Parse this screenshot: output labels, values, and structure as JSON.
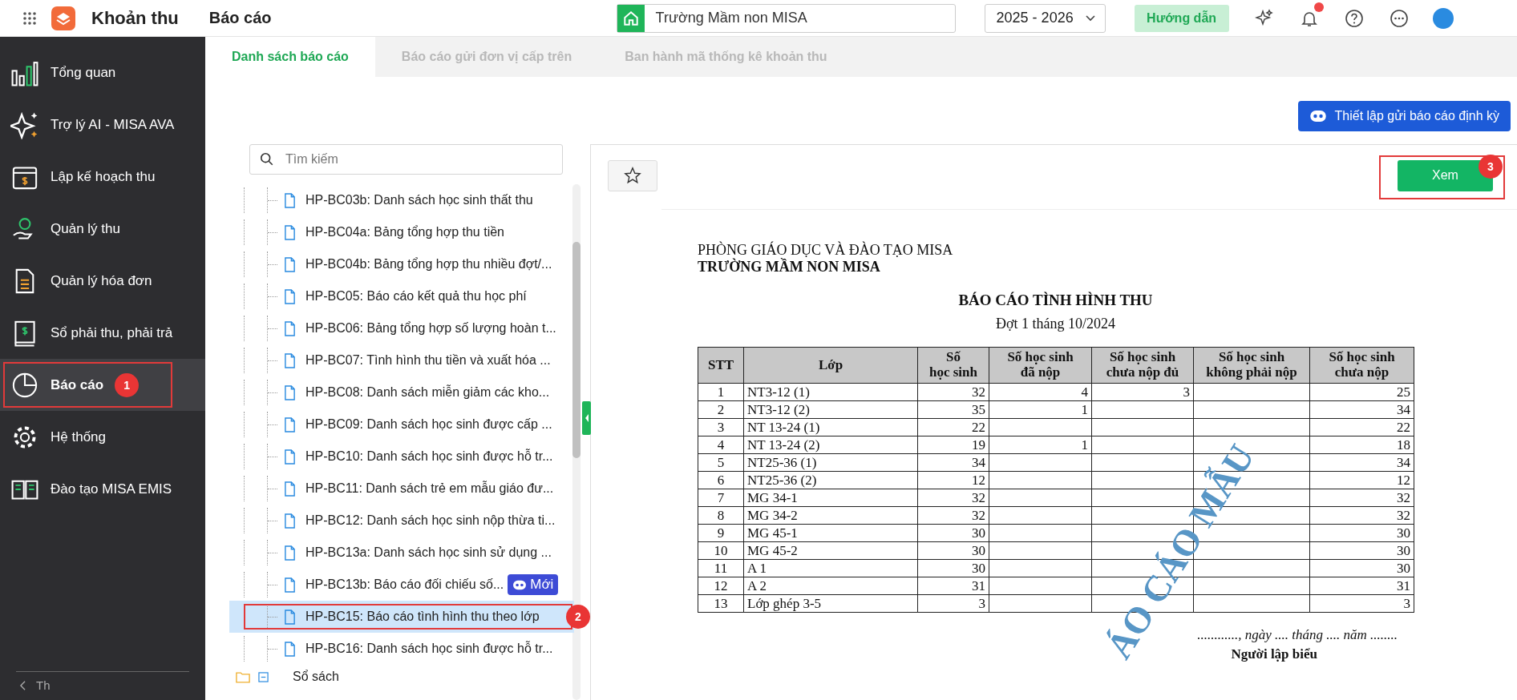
{
  "topbar": {
    "app_name": "Khoản thu",
    "page_title": "Báo cáo",
    "school": "Trường Mầm non MISA",
    "year": "2025 - 2026",
    "help_button": "Hướng dẫn"
  },
  "tabs": [
    {
      "label": "Danh sách báo cáo",
      "selected": true
    },
    {
      "label": "Báo cáo gửi đơn vị cấp trên",
      "selected": false
    },
    {
      "label": "Ban hành mã thống kê khoản thu",
      "selected": false
    }
  ],
  "sidebar": {
    "items": [
      {
        "label": "Tổng quan",
        "selected": false
      },
      {
        "label": "Trợ lý AI - MISA AVA",
        "selected": false
      },
      {
        "label": "Lập kế hoạch thu",
        "selected": false
      },
      {
        "label": "Quản lý thu",
        "selected": false
      },
      {
        "label": "Quản lý hóa đơn",
        "selected": false
      },
      {
        "label": "Sổ phải thu, phải trả",
        "selected": false
      },
      {
        "label": "Báo cáo",
        "selected": true,
        "callout": "1"
      },
      {
        "label": "Hệ thống",
        "selected": false
      },
      {
        "label": "Đào tạo MISA EMIS",
        "selected": false
      }
    ],
    "collapse_label": "Th"
  },
  "schedule_button": "Thiết lập gửi báo cáo định kỳ",
  "report_list": {
    "search_placeholder": "Tìm kiếm",
    "items": [
      {
        "label": "HP-BC03b: Danh sách học sinh thất thu",
        "selected": false
      },
      {
        "label": "HP-BC04a: Bảng tổng hợp thu tiền",
        "selected": false
      },
      {
        "label": "HP-BC04b: Bảng tổng hợp thu nhiều đợt/...",
        "selected": false
      },
      {
        "label": "HP-BC05: Báo cáo kết quả thu học phí",
        "selected": false
      },
      {
        "label": "HP-BC06: Bảng tổng hợp số lượng hoàn t...",
        "selected": false
      },
      {
        "label": "HP-BC07: Tình hình thu tiền và xuất hóa ...",
        "selected": false
      },
      {
        "label": "HP-BC08: Danh sách miễn giảm các kho...",
        "selected": false
      },
      {
        "label": "HP-BC09: Danh sách học sinh được cấp ...",
        "selected": false
      },
      {
        "label": "HP-BC10: Danh sách học sinh được hỗ tr...",
        "selected": false
      },
      {
        "label": "HP-BC11: Danh sách trẻ em mẫu giáo đư...",
        "selected": false
      },
      {
        "label": "HP-BC12: Danh sách học sinh nộp thừa ti...",
        "selected": false
      },
      {
        "label": "HP-BC13a: Danh sách học sinh sử dụng ...",
        "selected": false
      },
      {
        "label": "HP-BC13b: Báo cáo đối chiếu số...",
        "selected": false,
        "badge": "Mới"
      },
      {
        "label": "HP-BC15: Báo cáo tình hình thu theo lớp",
        "selected": true,
        "callout": "2"
      },
      {
        "label": "HP-BC16: Danh sách học sinh được hỗ tr...",
        "selected": false
      }
    ],
    "folder": {
      "label": "Sổ sách",
      "expanded": true
    }
  },
  "preview": {
    "view_button": "Xem",
    "view_callout": "3",
    "document": {
      "department": "PHÒNG GIÁO DỤC VÀ ĐÀO TẠO MISA",
      "school": "TRƯỜNG MẦM NON MISA",
      "title": "BÁO CÁO TÌNH HÌNH THU",
      "subtitle": "Đợt 1 tháng 10/2024",
      "columns": [
        "STT",
        "Lớp",
        "Số\nhọc sinh",
        "Số học sinh\nđã nộp",
        "Số học sinh\nchưa nộp đủ",
        "Số học sinh\nkhông phải nộp",
        "Số học sinh\nchưa nộp"
      ],
      "rows": [
        [
          "1",
          "NT3-12 (1)",
          "32",
          "4",
          "3",
          null,
          "25"
        ],
        [
          "2",
          "NT3-12 (2)",
          "35",
          "1",
          null,
          null,
          "34"
        ],
        [
          "3",
          "NT 13-24 (1)",
          "22",
          null,
          null,
          null,
          "22"
        ],
        [
          "4",
          "NT 13-24 (2)",
          "19",
          "1",
          null,
          null,
          "18"
        ],
        [
          "5",
          "NT25-36 (1)",
          "34",
          null,
          null,
          null,
          "34"
        ],
        [
          "6",
          "NT25-36 (2)",
          "12",
          null,
          null,
          null,
          "12"
        ],
        [
          "7",
          "MG 34-1",
          "32",
          null,
          null,
          null,
          "32"
        ],
        [
          "8",
          "MG 34-2",
          "32",
          null,
          null,
          null,
          "32"
        ],
        [
          "9",
          "MG 45-1",
          "30",
          null,
          null,
          null,
          "30"
        ],
        [
          "10",
          "MG 45-2",
          "30",
          null,
          null,
          null,
          "30"
        ],
        [
          "11",
          "A 1",
          "30",
          null,
          null,
          null,
          "30"
        ],
        [
          "12",
          "A 2",
          "31",
          null,
          null,
          null,
          "31"
        ],
        [
          "13",
          "Lớp ghép 3-5",
          "3",
          null,
          null,
          null,
          "3"
        ]
      ],
      "footer_date": "............, ngày .... tháng .... năm ........",
      "footer_signer": "Người lập biểu",
      "stamp": "ÁO CÁO MẪU"
    }
  }
}
